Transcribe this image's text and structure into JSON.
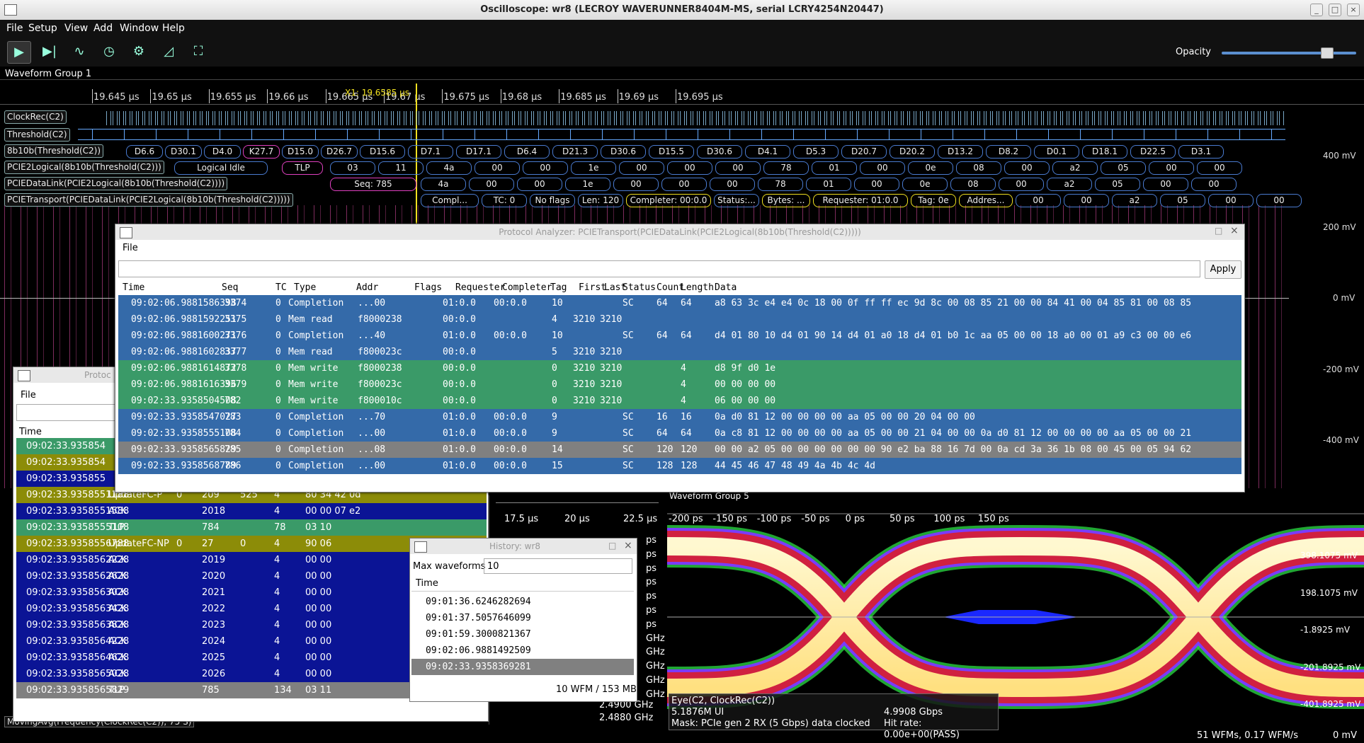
{
  "window": {
    "title": "Oscilloscope: wr8 (LECROY WAVERUNNER8404M-MS, serial LCRY4254N20447)"
  },
  "menu": [
    "File",
    "Setup",
    "View",
    "Add",
    "Window",
    "Help"
  ],
  "toolbar": {
    "opacity_label": "Opacity",
    "opacity_level": 0.82
  },
  "groups": {
    "g1": "Waveform Group 1",
    "g5": "Waveform Group 5"
  },
  "timeline": {
    "ticks": [
      "19.645 µs",
      "19.65 µs",
      "19.655 µs",
      "19.66 µs",
      "19.665 µs",
      "19.67 µs",
      "19.675 µs",
      "19.68 µs",
      "19.685 µs",
      "19.69 µs",
      "19.695 µs"
    ],
    "cursor": "X1: 19.6585 µs"
  },
  "channels": [
    "ClockRec(C2)",
    "Threshold(C2)",
    "8b10b(Threshold(C2))",
    "PCIE2Logical(8b10b(Threshold(C2)))",
    "PCIEDataLink(PCIE2Logical(8b10b(Threshold(C2))))",
    "PCIETransport(PCIEDataLink(PCIE2Logical(8b10b(Threshold(C2)))))"
  ],
  "symbols_8b10b": [
    "D6.6",
    "D30.1",
    "D4.0",
    "K27.7",
    "D15.0",
    "D26.7",
    "D15.6",
    "D7.1",
    "D17.1",
    "D6.4",
    "D21.3",
    "D30.6",
    "D15.5",
    "D30.6",
    "D4.1",
    "D5.3",
    "D20.7",
    "D20.2",
    "D13.2",
    "D8.2",
    "D0.1",
    "D18.1",
    "D22.5",
    "D3.1"
  ],
  "logical": {
    "idle": "Logical Idle",
    "tlp": "TLP",
    "bytes": [
      "03",
      "11",
      "4a",
      "00",
      "00",
      "1e",
      "00",
      "00",
      "00",
      "78",
      "01",
      "00",
      "0e",
      "08",
      "00",
      "a2",
      "05",
      "00",
      "00"
    ]
  },
  "datalink": {
    "seq": "Seq: 785",
    "bytes": [
      "4a",
      "00",
      "00",
      "1e",
      "00",
      "00",
      "00",
      "78",
      "01",
      "00",
      "0e",
      "08",
      "00",
      "a2",
      "05",
      "00",
      "00"
    ]
  },
  "transport": [
    "Compl...",
    "TC: 0",
    "No flags",
    "Len: 120",
    "Completer: 00:0.0",
    "Status:...",
    "Bytes: ...",
    "Requester: 01:0.0",
    "Tag: 0e",
    "Addres...",
    "00",
    "00",
    "a2",
    "05",
    "00",
    "00"
  ],
  "voltage_labels": [
    "400 mV",
    "200 mV",
    "0 mV",
    "-200 mV",
    "-400 mV"
  ],
  "protocol_analyzer": {
    "title": "Protocol Analyzer: PCIETransport(PCIEDataLink(PCIE2Logical(8b10b(Threshold(C2)))))",
    "menu": "File",
    "apply": "Apply",
    "columns": [
      "Time",
      "Seq",
      "TC",
      "Type",
      "Addr",
      "Flags",
      "Requester",
      "Completer",
      "Tag",
      "First",
      "Last",
      "Status",
      "Count",
      "Length",
      "Data"
    ],
    "rows": [
      {
        "color": "blue",
        "time": "09:02:06.9881586398",
        "seq": "3374",
        "tc": "0",
        "type": "Completion",
        "addr": "...00",
        "req": "01:0.0",
        "cpl": "00:0.0",
        "tag": "10",
        "first": "",
        "last": "",
        "status": "SC",
        "count": "64",
        "len": "64",
        "data": "a8 63 3c e4 e4 0c 18 00 0f ff ff ec 9d 8c 00 08 85 21 00 00 84 41 00 04 85 81 00 08 85"
      },
      {
        "color": "blue",
        "time": "09:02:06.9881592251",
        "seq": "3375",
        "tc": "0",
        "type": "Mem read",
        "addr": "f8000238",
        "req": "00:0.0",
        "cpl": "",
        "tag": "4",
        "first": "3210",
        "last": "3210",
        "status": "",
        "count": "",
        "len": "",
        "data": ""
      },
      {
        "color": "blue",
        "time": "09:02:06.9881600271",
        "seq": "3376",
        "tc": "0",
        "type": "Completion",
        "addr": "...40",
        "req": "01:0.0",
        "cpl": "00:0.0",
        "tag": "10",
        "first": "",
        "last": "",
        "status": "SC",
        "count": "64",
        "len": "64",
        "data": "d4 01 80 10 d4 01 90 14 d4 01 a0 18 d4 01 b0 1c aa 05 00 00 18 a0 00 01 a9 c3 00 00 e6"
      },
      {
        "color": "blue",
        "time": "09:02:06.9881602837",
        "seq": "3377",
        "tc": "0",
        "type": "Mem read",
        "addr": "f800023c",
        "req": "00:0.0",
        "cpl": "",
        "tag": "5",
        "first": "3210",
        "last": "3210",
        "status": "",
        "count": "",
        "len": "",
        "data": ""
      },
      {
        "color": "green",
        "time": "09:02:06.9881614872",
        "seq": "3378",
        "tc": "0",
        "type": "Mem write",
        "addr": "f8000238",
        "req": "00:0.0",
        "cpl": "",
        "tag": "0",
        "first": "3210",
        "last": "3210",
        "status": "",
        "count": "",
        "len": "4",
        "data": "d8 9f d0 1e"
      },
      {
        "color": "green",
        "time": "09:02:06.9881616396",
        "seq": "3379",
        "tc": "0",
        "type": "Mem write",
        "addr": "f800023c",
        "req": "00:0.0",
        "cpl": "",
        "tag": "0",
        "first": "3210",
        "last": "3210",
        "status": "",
        "count": "",
        "len": "4",
        "data": "00 00 00 00"
      },
      {
        "color": "green",
        "time": "09:02:33.9358504508",
        "seq": "782",
        "tc": "0",
        "type": "Mem write",
        "addr": "f800010c",
        "req": "00:0.0",
        "cpl": "",
        "tag": "0",
        "first": "3210",
        "last": "3210",
        "status": "",
        "count": "",
        "len": "4",
        "data": "06 00 00 00"
      },
      {
        "color": "blue",
        "time": "09:02:33.9358547027",
        "seq": "783",
        "tc": "0",
        "type": "Completion",
        "addr": "...70",
        "req": "01:0.0",
        "cpl": "00:0.0",
        "tag": "9",
        "first": "",
        "last": "",
        "status": "SC",
        "count": "16",
        "len": "16",
        "data": "0a d0 81 12 00 00 00 00 aa 05 00 00 20 04 00 00"
      },
      {
        "color": "blue",
        "time": "09:02:33.9358555108",
        "seq": "784",
        "tc": "0",
        "type": "Completion",
        "addr": "...00",
        "req": "01:0.0",
        "cpl": "00:0.0",
        "tag": "9",
        "first": "",
        "last": "",
        "status": "SC",
        "count": "64",
        "len": "64",
        "data": "0a c8 81 12 00 00 00 00 aa 05 00 00 21 04 00 00 0a d0 81 12 00 00 00 00 aa 05 00 00 21"
      },
      {
        "color": "grey",
        "time": "09:02:33.9358565829",
        "seq": "785",
        "tc": "0",
        "type": "Completion",
        "addr": "...08",
        "req": "01:0.0",
        "cpl": "00:0.0",
        "tag": "14",
        "first": "",
        "last": "",
        "status": "SC",
        "count": "120",
        "len": "120",
        "data": "00 00 a2 05 00 00 00 00 00 00 90 e2 ba 88 16 7d 00 0a cd 3a 36 1b 08 00 45 00 05 94 62"
      },
      {
        "color": "blue",
        "time": "09:02:33.9358568789",
        "seq": "786",
        "tc": "0",
        "type": "Completion",
        "addr": "...00",
        "req": "01:0.0",
        "cpl": "00:0.0",
        "tag": "15",
        "first": "",
        "last": "",
        "status": "SC",
        "count": "128",
        "len": "128",
        "data": "44 45 46 47 48 49 4a 4b 4c 4d"
      }
    ]
  },
  "dll_analyzer": {
    "title": "Protoc",
    "menu": "File",
    "col_time": "Time",
    "partial_rows": [
      "09:02:33.935854",
      "09:02:33.935854",
      "09:02:33.935855"
    ],
    "rows": [
      {
        "color": "olive",
        "time": "09:02:33.9358551188",
        "type": "UpdateFC-P",
        "a": "0",
        "b": "209",
        "c": "525",
        "d": "4",
        "data": "80 34 42 0d"
      },
      {
        "color": "navy",
        "time": "09:02:33.9358551588",
        "type": "ACK",
        "a": "",
        "b": "2018",
        "c": "",
        "d": "4",
        "data": "00 00 07 e2"
      },
      {
        "color": "green",
        "time": "09:02:33.9358555108",
        "type": "TLP",
        "a": "",
        "b": "784",
        "c": "",
        "d": "78",
        "data": "03 10"
      },
      {
        "color": "olive",
        "time": "09:02:33.9358556788",
        "type": "UpdateFC-NP",
        "a": "0",
        "b": "27",
        "c": "0",
        "d": "4",
        "data": "90 06"
      },
      {
        "color": "navy",
        "time": "09:02:33.9358562228",
        "type": "ACK",
        "a": "",
        "b": "2019",
        "c": "",
        "d": "4",
        "data": "00 00"
      },
      {
        "color": "navy",
        "time": "09:02:33.9358562628",
        "type": "ACK",
        "a": "",
        "b": "2020",
        "c": "",
        "d": "4",
        "data": "00 00"
      },
      {
        "color": "navy",
        "time": "09:02:33.9358563028",
        "type": "ACK",
        "a": "",
        "b": "2021",
        "c": "",
        "d": "4",
        "data": "00 00"
      },
      {
        "color": "navy",
        "time": "09:02:33.9358563428",
        "type": "ACK",
        "a": "",
        "b": "2022",
        "c": "",
        "d": "4",
        "data": "00 00"
      },
      {
        "color": "navy",
        "time": "09:02:33.9358563828",
        "type": "ACK",
        "a": "",
        "b": "2023",
        "c": "",
        "d": "4",
        "data": "00 00"
      },
      {
        "color": "navy",
        "time": "09:02:33.9358564228",
        "type": "ACK",
        "a": "",
        "b": "2024",
        "c": "",
        "d": "4",
        "data": "00 00"
      },
      {
        "color": "navy",
        "time": "09:02:33.9358564628",
        "type": "ACK",
        "a": "",
        "b": "2025",
        "c": "",
        "d": "4",
        "data": "00 00"
      },
      {
        "color": "navy",
        "time": "09:02:33.9358565028",
        "type": "ACK",
        "a": "",
        "b": "2026",
        "c": "",
        "d": "4",
        "data": "00 00"
      },
      {
        "color": "grey",
        "time": "09:02:33.9358565829",
        "type": "TLP",
        "a": "",
        "b": "785",
        "c": "",
        "d": "134",
        "data": "03 11"
      }
    ]
  },
  "history": {
    "title": "History: wr8",
    "max_label": "Max waveforms",
    "max_value": "10",
    "col_time": "Time",
    "rows": [
      "09:01:36.6246282694",
      "09:01:37.5057646099",
      "09:01:59.3000821367",
      "09:02:06.9881492509",
      "09:02:33.9358369281"
    ],
    "selected": 4,
    "footer": "10 WFM / 153 MB"
  },
  "group4": {
    "ticks": [
      "17.5 µs",
      "20 µs",
      "22.5 µs"
    ],
    "units": [
      "ps",
      "ps",
      "ps",
      "ps",
      "ps",
      "ps",
      "ps",
      "GHz",
      "GHz",
      "GHz",
      "GHz",
      "GHz"
    ],
    "freq": [
      "2.4900 GHz",
      "2.4880 GHz"
    ],
    "footer_label": "MovingAvg(Frequency(ClockRec(C2)), 75 S)"
  },
  "eye": {
    "ticks": [
      "-200 ps",
      "-150 ps",
      "-100 ps",
      "-50 ps",
      "0 ps",
      "50 ps",
      "100 ps",
      "150 ps"
    ],
    "vlabels": [
      "398.1075 mV",
      "198.1075 mV",
      "-1.8925 mV",
      "-201.8925 mV",
      "-401.8925 mV"
    ],
    "info": [
      "Eye(C2, ClockRec(C2))",
      "5.1876M UI",
      "Mask: PCIe gen 2 RX (5 Gbps) data clocked"
    ],
    "rate": "4.9908 Gbps",
    "hit": "Hit rate: 0.00e+00(PASS)",
    "footer": "51 WFMs, 0.17 WFM/s",
    "footer_v": "0 mV"
  }
}
